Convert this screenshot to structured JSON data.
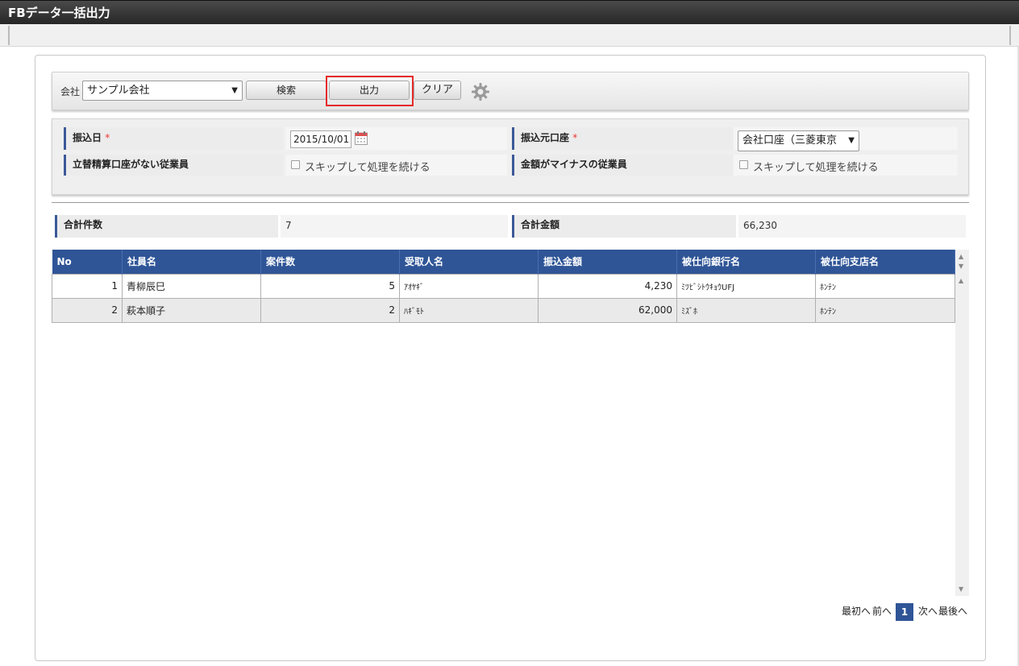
{
  "window": {
    "title": "FBデータ一括出力"
  },
  "toolbar": {
    "company_label": "会社",
    "company_value": "サンプル会社",
    "search_label": "検索",
    "output_label": "出力",
    "clear_label": "クリア"
  },
  "criteria": {
    "transfer_date_label": "振込日",
    "transfer_date_value": "2015/10/01",
    "source_account_label": "振込元口座",
    "source_account_value": "会社口座（三菱東京",
    "no_reimburse_label": "立替精算口座がない従業員",
    "no_reimburse_option": "スキップして処理を続ける",
    "negative_amount_label": "金額がマイナスの従業員",
    "negative_amount_option": "スキップして処理を続ける",
    "required_mark": "*"
  },
  "summary": {
    "count_label": "合計件数",
    "count_value": "7",
    "amount_label": "合計金額",
    "amount_value": "66,230"
  },
  "table": {
    "columns": [
      "No",
      "社員名",
      "案件数",
      "受取人名",
      "振込金額",
      "被仕向銀行名",
      "被仕向支店名"
    ],
    "rows": [
      [
        "1",
        "青柳辰巳",
        "5",
        "ｱｵﾔｷﾞ",
        "4,230",
        "ﾐﾂﾋﾞｼﾄｳｷｮｳUFJ",
        "ﾎﾝﾃﾝ"
      ],
      [
        "2",
        "萩本順子",
        "2",
        "ﾊｷﾞﾓﾄ",
        "62,000",
        "ﾐｽﾞﾎ",
        "ﾎﾝﾃﾝ"
      ]
    ]
  },
  "pager": {
    "first": "最初へ",
    "prev": "前へ",
    "current": "1",
    "next": "次へ",
    "last": "最後へ"
  },
  "colors": {
    "accent": "#2f5597",
    "focus": "#e52a2a",
    "required": "#e33333"
  }
}
